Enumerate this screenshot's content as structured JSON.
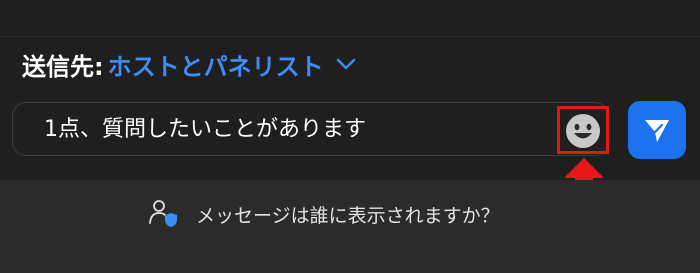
{
  "recipient": {
    "label": "送信先:",
    "value": "ホストとパネリスト"
  },
  "message": {
    "value": "1点、質問したいことがあります"
  },
  "footer": {
    "visibility_text": "メッセージは誰に表示されますか？"
  },
  "colors": {
    "background": "#1f1f20",
    "footer_background": "#2b2b2c",
    "accent": "#3f8cf2",
    "send_button": "#1d72f0",
    "highlight": "#e5161c",
    "emoji": "#c8c8c8"
  },
  "icons": {
    "chevron": "chevron-down-icon",
    "emoji": "emoji-icon",
    "send": "send-icon",
    "visibility": "user-shield-icon",
    "annotation": "red-arrow-up"
  }
}
